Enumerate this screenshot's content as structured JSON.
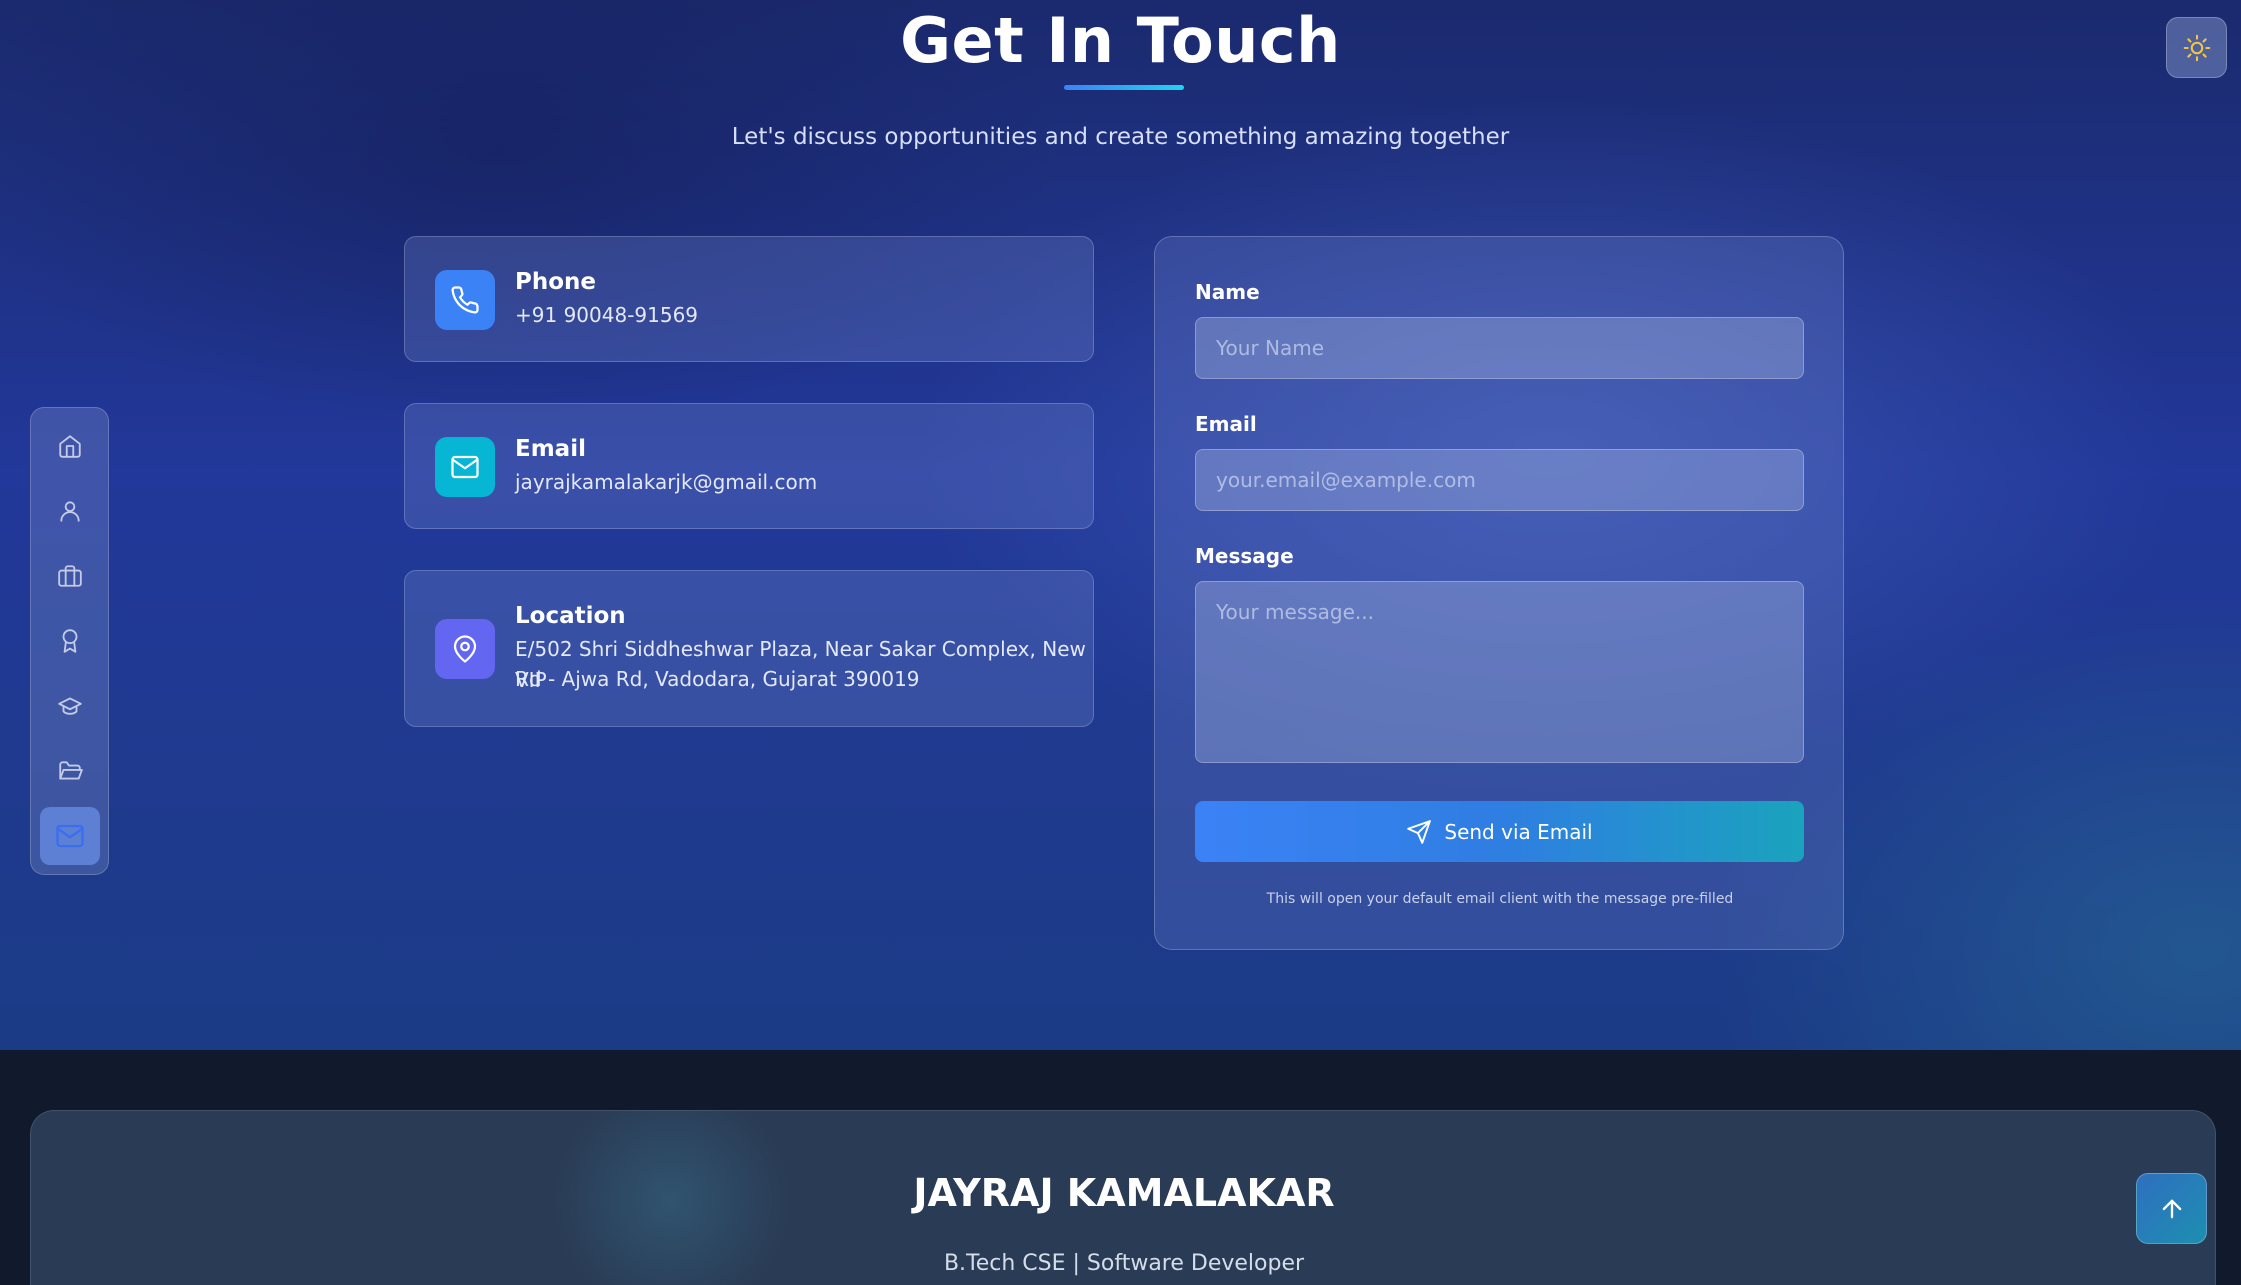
{
  "header": {
    "title": "Get In Touch",
    "subtitle": "Let's discuss opportunities and create something amazing together"
  },
  "theme_toggle": {
    "icon": "sun-icon"
  },
  "sidenav": {
    "items": [
      {
        "icon": "home-icon",
        "active": false
      },
      {
        "icon": "user-icon",
        "active": false
      },
      {
        "icon": "briefcase-icon",
        "active": false
      },
      {
        "icon": "award-icon",
        "active": false
      },
      {
        "icon": "graduation-cap-icon",
        "active": false
      },
      {
        "icon": "folder-icon",
        "active": false
      },
      {
        "icon": "mail-icon",
        "active": true
      }
    ]
  },
  "contact_info": {
    "phone": {
      "label": "Phone",
      "value": "+91 90048-91569",
      "icon": "phone-icon",
      "color": "#3b82f6"
    },
    "email": {
      "label": "Email",
      "value": "jayrajkamalakarjk@gmail.com",
      "icon": "mail-icon",
      "color": "#06b6d4"
    },
    "location": {
      "label": "Location",
      "value_line1": "E/502 Shri Siddheshwar Plaza, Near Sakar Complex, New VIP",
      "value_line2": "Rd - Ajwa Rd, Vadodara, Gujarat 390019",
      "icon": "map-pin-icon",
      "color": "#6366f1"
    }
  },
  "form": {
    "name_label": "Name",
    "name_placeholder": "Your Name",
    "name_value": "",
    "email_label": "Email",
    "email_placeholder": "your.email@example.com",
    "email_value": "",
    "message_label": "Message",
    "message_placeholder": "Your message...",
    "message_value": "",
    "send_label": "Send via Email",
    "send_icon": "send-icon",
    "note": "This will open your default email client with the message pre-filled"
  },
  "footer": {
    "name": "JAYRAJ KAMALAKAR",
    "role": "B.Tech CSE | Software Developer"
  },
  "scroll_top": {
    "icon": "arrow-up-icon"
  }
}
